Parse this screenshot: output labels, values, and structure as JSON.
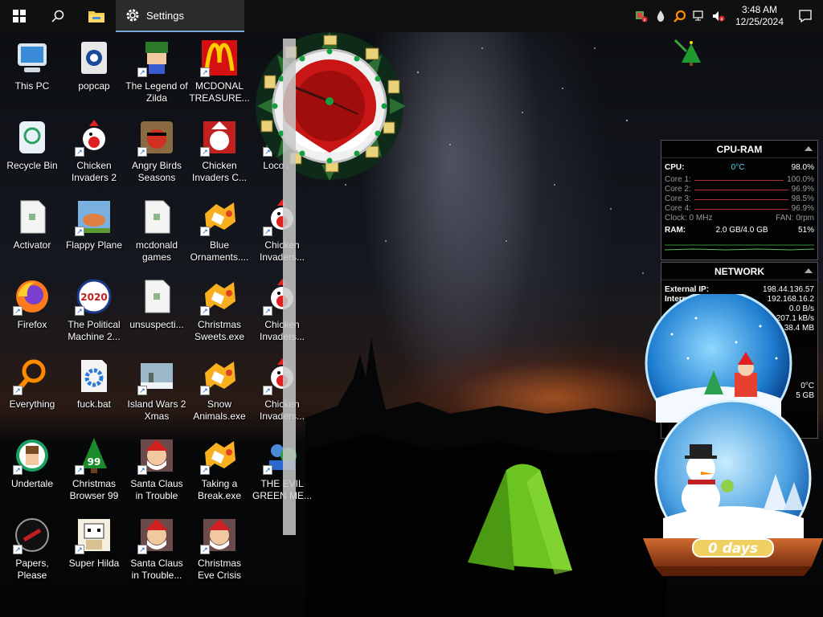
{
  "taskbar": {
    "active_app": "Settings",
    "time": "3:48 AM",
    "date": "12/25/2024"
  },
  "desktop_icons": [
    {
      "label": "This PC",
      "icon": "computer-icon"
    },
    {
      "label": "popcap",
      "icon": "popcap-icon"
    },
    {
      "label": "The Legend of Zilda",
      "icon": "legend-zilda-icon"
    },
    {
      "label": "MCDONAL TREASURE...",
      "icon": "mcdonalds-icon"
    },
    {
      "label": "Recycle Bin",
      "icon": "recycle-bin-icon"
    },
    {
      "label": "Chicken Invaders 2",
      "icon": "chicken-icon"
    },
    {
      "label": "Angry Birds Seasons",
      "icon": "angry-birds-icon"
    },
    {
      "label": "Chicken Invaders C...",
      "icon": "chicken-santa-icon"
    },
    {
      "label": "Loco Xm",
      "icon": "loco-icon"
    },
    {
      "label": "Activator",
      "icon": "file-icon"
    },
    {
      "label": "Flappy Plane",
      "icon": "flappy-plane-icon"
    },
    {
      "label": "mcdonald games",
      "icon": "file-icon"
    },
    {
      "label": "Blue Ornaments....",
      "icon": "puzzle-icon"
    },
    {
      "label": "Chicken Invaders...",
      "icon": "chicken-icon"
    },
    {
      "label": "Firefox",
      "icon": "firefox-icon"
    },
    {
      "label": "The Political Machine 2...",
      "icon": "political-machine-icon"
    },
    {
      "label": "unsuspecti...",
      "icon": "file-icon"
    },
    {
      "label": "Christmas Sweets.exe",
      "icon": "puzzle-icon"
    },
    {
      "label": "Chicken Invaders...",
      "icon": "chicken-icon"
    },
    {
      "label": "Everything",
      "icon": "everything-search-icon"
    },
    {
      "label": "fuck.bat",
      "icon": "batch-gear-icon"
    },
    {
      "label": "Island Wars 2 Xmas",
      "icon": "island-wars-icon"
    },
    {
      "label": "Snow Animals.exe",
      "icon": "puzzle-icon"
    },
    {
      "label": "Chicken Invaders...",
      "icon": "chicken-icon"
    },
    {
      "label": "Undertale",
      "icon": "undertale-icon"
    },
    {
      "label": "Christmas Browser 99",
      "icon": "christmas-tree-icon"
    },
    {
      "label": "Santa Claus in Trouble",
      "icon": "santa-icon"
    },
    {
      "label": "Taking a Break.exe",
      "icon": "puzzle-icon"
    },
    {
      "label": "THE EVIL GREEN ME...",
      "icon": "evil-green-icon"
    },
    {
      "label": "Papers, Please",
      "icon": "papers-please-icon"
    },
    {
      "label": "Super Hilda",
      "icon": "super-hilda-icon"
    },
    {
      "label": "Santa Claus in Trouble... A...",
      "icon": "santa-icon"
    },
    {
      "label": "Christmas Eve Crisis",
      "icon": "santa-icon"
    }
  ],
  "cpu_widget": {
    "title": "CPU-RAM",
    "cpu_label": "CPU:",
    "cpu_temp": "0°C",
    "cpu_usage": "98.0%",
    "cores": [
      {
        "label": "Core 1:",
        "value": "100.0%"
      },
      {
        "label": "Core 2:",
        "value": "96.9%"
      },
      {
        "label": "Core 3:",
        "value": "98.5%"
      },
      {
        "label": "Core 4:",
        "value": "96.9%"
      }
    ],
    "clock": "Clock: 0 MHz",
    "fan": "FAN: 0rpm",
    "ram_label": "RAM:",
    "ram_used": "2.0 GB/4.0 GB",
    "ram_percent": "51%"
  },
  "network_widget": {
    "title": "NETWORK",
    "external_ip_label": "External IP:",
    "external_ip": "198.44.136.57",
    "internal_ip_label": "Internal",
    "internal_ip": "192.168.16.2",
    "rate1": "0.0 B/s",
    "rate2": "207.1 kB/s",
    "total": "38.4 MB",
    "temp": "0°C",
    "storage": "5 GB"
  },
  "countdown": {
    "text": "0 days"
  },
  "colors": {
    "taskbar": "#101010",
    "accent": "#7aa8d8",
    "widget_cyan": "#5fd1ff"
  }
}
